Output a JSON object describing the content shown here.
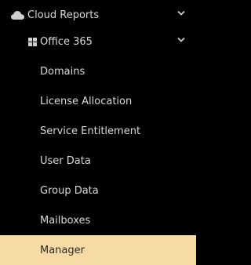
{
  "menu": {
    "section": {
      "label": "Cloud Reports",
      "icon": "cloud-icon",
      "expand_icon": "chevron-down-icon"
    },
    "group": {
      "label": "Office 365",
      "icon": "windows-icon",
      "expand_icon": "chevron-down-icon"
    },
    "items": [
      {
        "label": "Domains",
        "active": false
      },
      {
        "label": "License Allocation",
        "active": false
      },
      {
        "label": "Service Entitlement",
        "active": false
      },
      {
        "label": "User Data",
        "active": false
      },
      {
        "label": "Group Data",
        "active": false
      },
      {
        "label": "Mailboxes",
        "active": false
      },
      {
        "label": "Manager",
        "active": true
      }
    ]
  },
  "colors": {
    "background": "#000000",
    "text": "#d8d8d8",
    "active_background": "#f6dca4",
    "active_text": "#2a2a2a"
  }
}
